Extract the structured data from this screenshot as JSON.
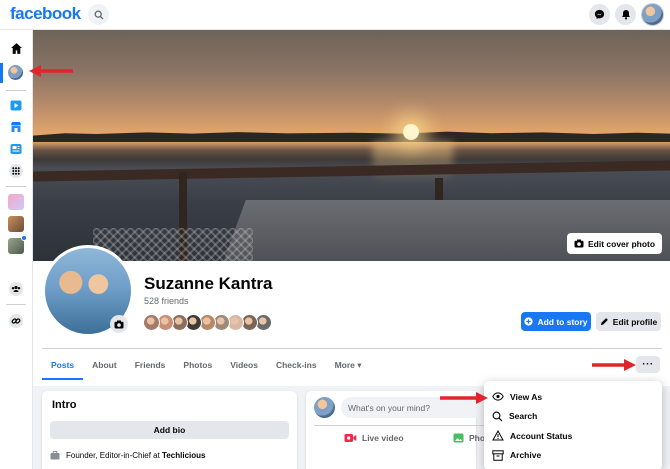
{
  "app": {
    "logo": "facebook"
  },
  "topbar": {
    "icons": [
      "search-icon",
      "messenger-icon",
      "bell-icon",
      "avatar"
    ]
  },
  "rail": {
    "icons": [
      "home-icon",
      "profile-avatar",
      "watch-icon",
      "marketplace-icon",
      "news-icon",
      "grid-icon",
      "group-avatar-1",
      "group-avatar-2",
      "group-avatar-3",
      "groups-icon",
      "link-icon"
    ]
  },
  "cover": {
    "edit_label": "Edit cover photo"
  },
  "profile": {
    "name": "Suzanne Kantra",
    "friends_label": "528 friends",
    "friend_avatar_colors": [
      "#a47b6a",
      "#c98f76",
      "#8a6e5e",
      "#3d3a38",
      "#b88967",
      "#9c8a7a",
      "#d6b9a4",
      "#7b6358",
      "#6a6a6a"
    ],
    "add_story_label": "Add to story",
    "edit_profile_label": "Edit profile"
  },
  "tabs": [
    {
      "label": "Posts",
      "active": true
    },
    {
      "label": "About"
    },
    {
      "label": "Friends"
    },
    {
      "label": "Photos"
    },
    {
      "label": "Videos"
    },
    {
      "label": "Check-ins"
    },
    {
      "label": "More ▾"
    }
  ],
  "more_button_label": "···",
  "intro": {
    "title": "Intro",
    "add_bio_label": "Add bio",
    "work_prefix": "Founder, Editor-in-Chief at ",
    "work_company": "Techlicious"
  },
  "composer": {
    "placeholder": "What's on your mind?",
    "live_label": "Live video",
    "photo_label": "Pho"
  },
  "menu": {
    "items": [
      {
        "label": "View As",
        "icon": "eye-icon"
      },
      {
        "label": "Search",
        "icon": "search-icon"
      },
      {
        "label": "Account Status",
        "icon": "warning-icon"
      },
      {
        "label": "Archive",
        "icon": "archive-icon"
      }
    ]
  },
  "colors": {
    "brand": "#1877f2",
    "annotation_arrow": "#e0262b"
  }
}
